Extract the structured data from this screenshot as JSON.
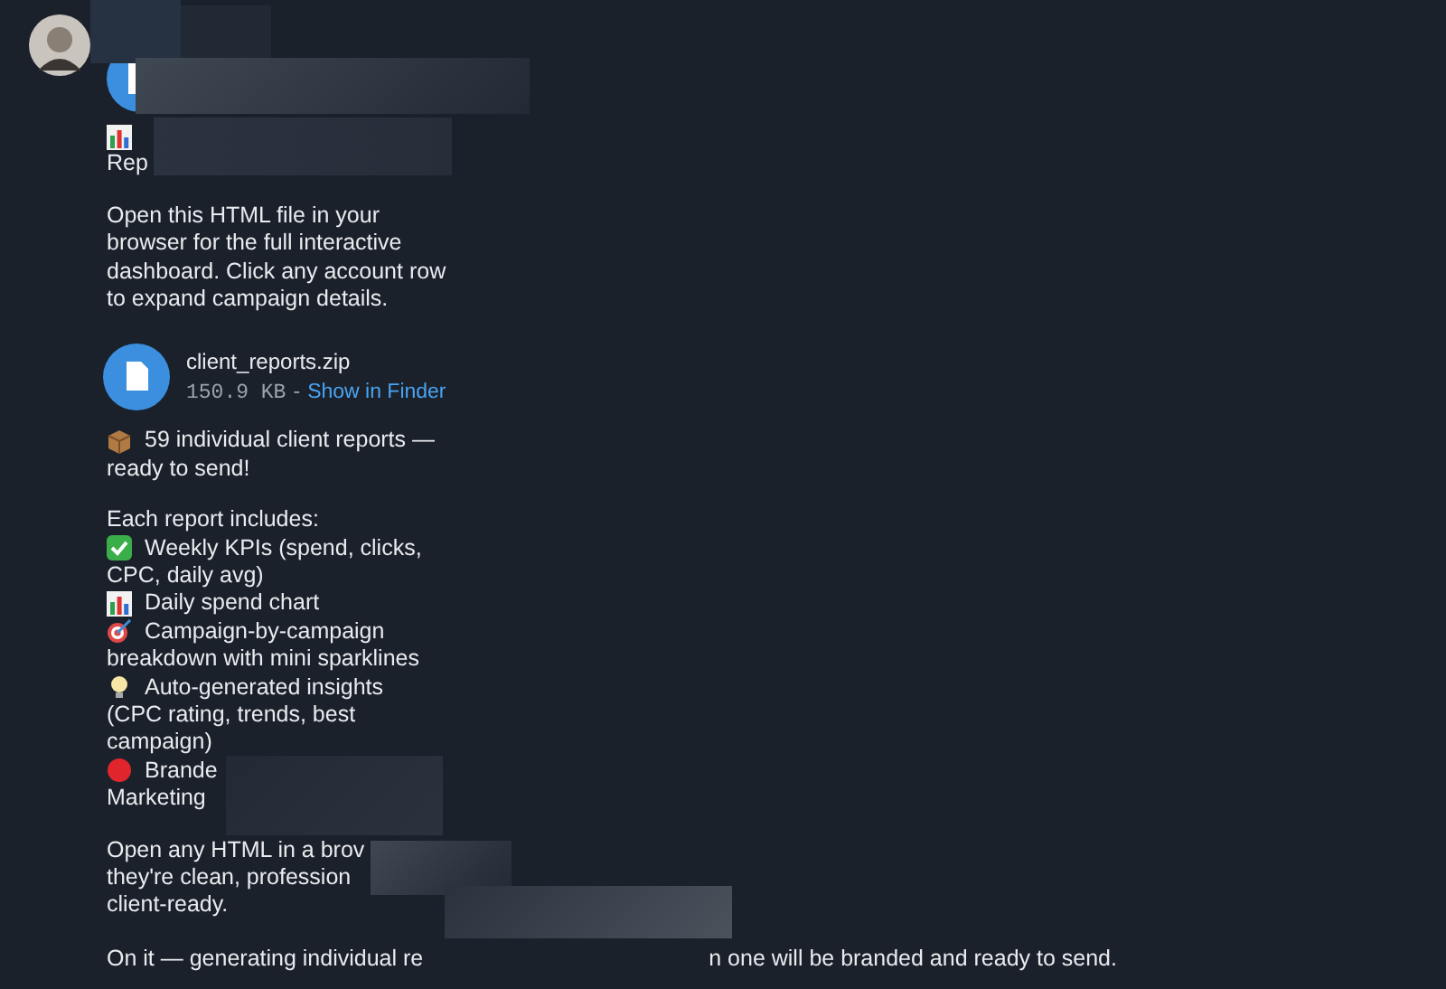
{
  "message": {
    "blocks": [
      {
        "kind": "file_partial"
      },
      {
        "kind": "icon_only"
      },
      {
        "kind": "text",
        "text": "Rep"
      },
      {
        "kind": "paragraph",
        "text": "Open this HTML file in your\nbrowser for the full interactive\ndashboard. Click any account row\nto expand campaign details."
      },
      {
        "kind": "file",
        "name": "client_reports.zip",
        "size": "150.9 KB",
        "separator": "-",
        "action": "Show in Finder"
      },
      {
        "kind": "item",
        "lines": [
          "59 individual client reports —",
          "ready to send!"
        ]
      },
      {
        "kind": "paragraph",
        "text": "Each report includes:"
      },
      {
        "kind": "item",
        "lines": [
          "Weekly KPIs (spend, clicks,",
          "CPC, daily avg)"
        ]
      },
      {
        "kind": "item",
        "lines": [
          "Daily spend chart"
        ]
      },
      {
        "kind": "item",
        "lines": [
          "Campaign-by-campaign",
          "breakdown with mini sparklines"
        ]
      },
      {
        "kind": "item",
        "lines": [
          "Auto-generated insights",
          "(CPC rating, trends, best\ncampaign)"
        ]
      },
      {
        "kind": "item",
        "lines": [
          "Brande",
          "Marketing"
        ]
      },
      {
        "kind": "paragraph",
        "text": "Open any HTML in a brov\nthey're clean, profession\nclient-ready."
      },
      {
        "kind": "split_line",
        "parts": [
          "On it — generating individual re",
          "n one will be branded and ready to send."
        ]
      }
    ]
  }
}
